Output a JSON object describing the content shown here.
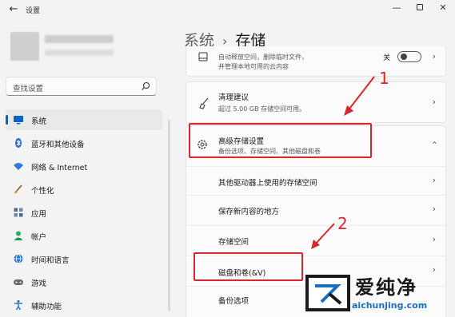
{
  "window": {
    "title": "设置"
  },
  "search": {
    "placeholder": "查找设置"
  },
  "nav": [
    {
      "label": "系统",
      "icon": "monitor-icon",
      "color": "#0067c0"
    },
    {
      "label": "蓝牙和其他设备",
      "icon": "bluetooth-icon",
      "color": "#2a6ad2"
    },
    {
      "label": "网络 & Internet",
      "icon": "wifi-icon",
      "color": "#2f7ad8"
    },
    {
      "label": "个性化",
      "icon": "brush-icon",
      "color": "#e08a2c"
    },
    {
      "label": "应用",
      "icon": "apps-icon",
      "color": "#4c6a8a"
    },
    {
      "label": "帐户",
      "icon": "person-icon",
      "color": "#2ea86b"
    },
    {
      "label": "时间和语言",
      "icon": "globe-icon",
      "color": "#2b7bd4"
    },
    {
      "label": "游戏",
      "icon": "gamepad-icon",
      "color": "#6a6a6a"
    },
    {
      "label": "辅助功能",
      "icon": "accessibility-icon",
      "color": "#2e76c5"
    }
  ],
  "breadcrumb": {
    "parent": "系统",
    "current": "存储"
  },
  "storage_sense": {
    "line1": "自动释放空间，删除临时文件，",
    "line2": "并管理本地可用的云内容",
    "toggle_label": "关"
  },
  "cleanup": {
    "title": "清理建议",
    "subtitle": "超过 5.00 GB 存储空间可用。"
  },
  "advanced": {
    "title": "高级存储设置",
    "subtitle": "备份选项、存储空间、其他磁盘和卷"
  },
  "subitems": [
    {
      "label": "其他驱动器上使用的存储空间"
    },
    {
      "label": "保存新内容的地方"
    },
    {
      "label": "存储空间"
    },
    {
      "label": "磁盘和卷(&V)"
    },
    {
      "label": "备份选项"
    }
  ],
  "annotations": {
    "first": "1",
    "second": "2"
  },
  "watermark": {
    "brand": "爱纯净",
    "url": "aichunjing.com"
  }
}
